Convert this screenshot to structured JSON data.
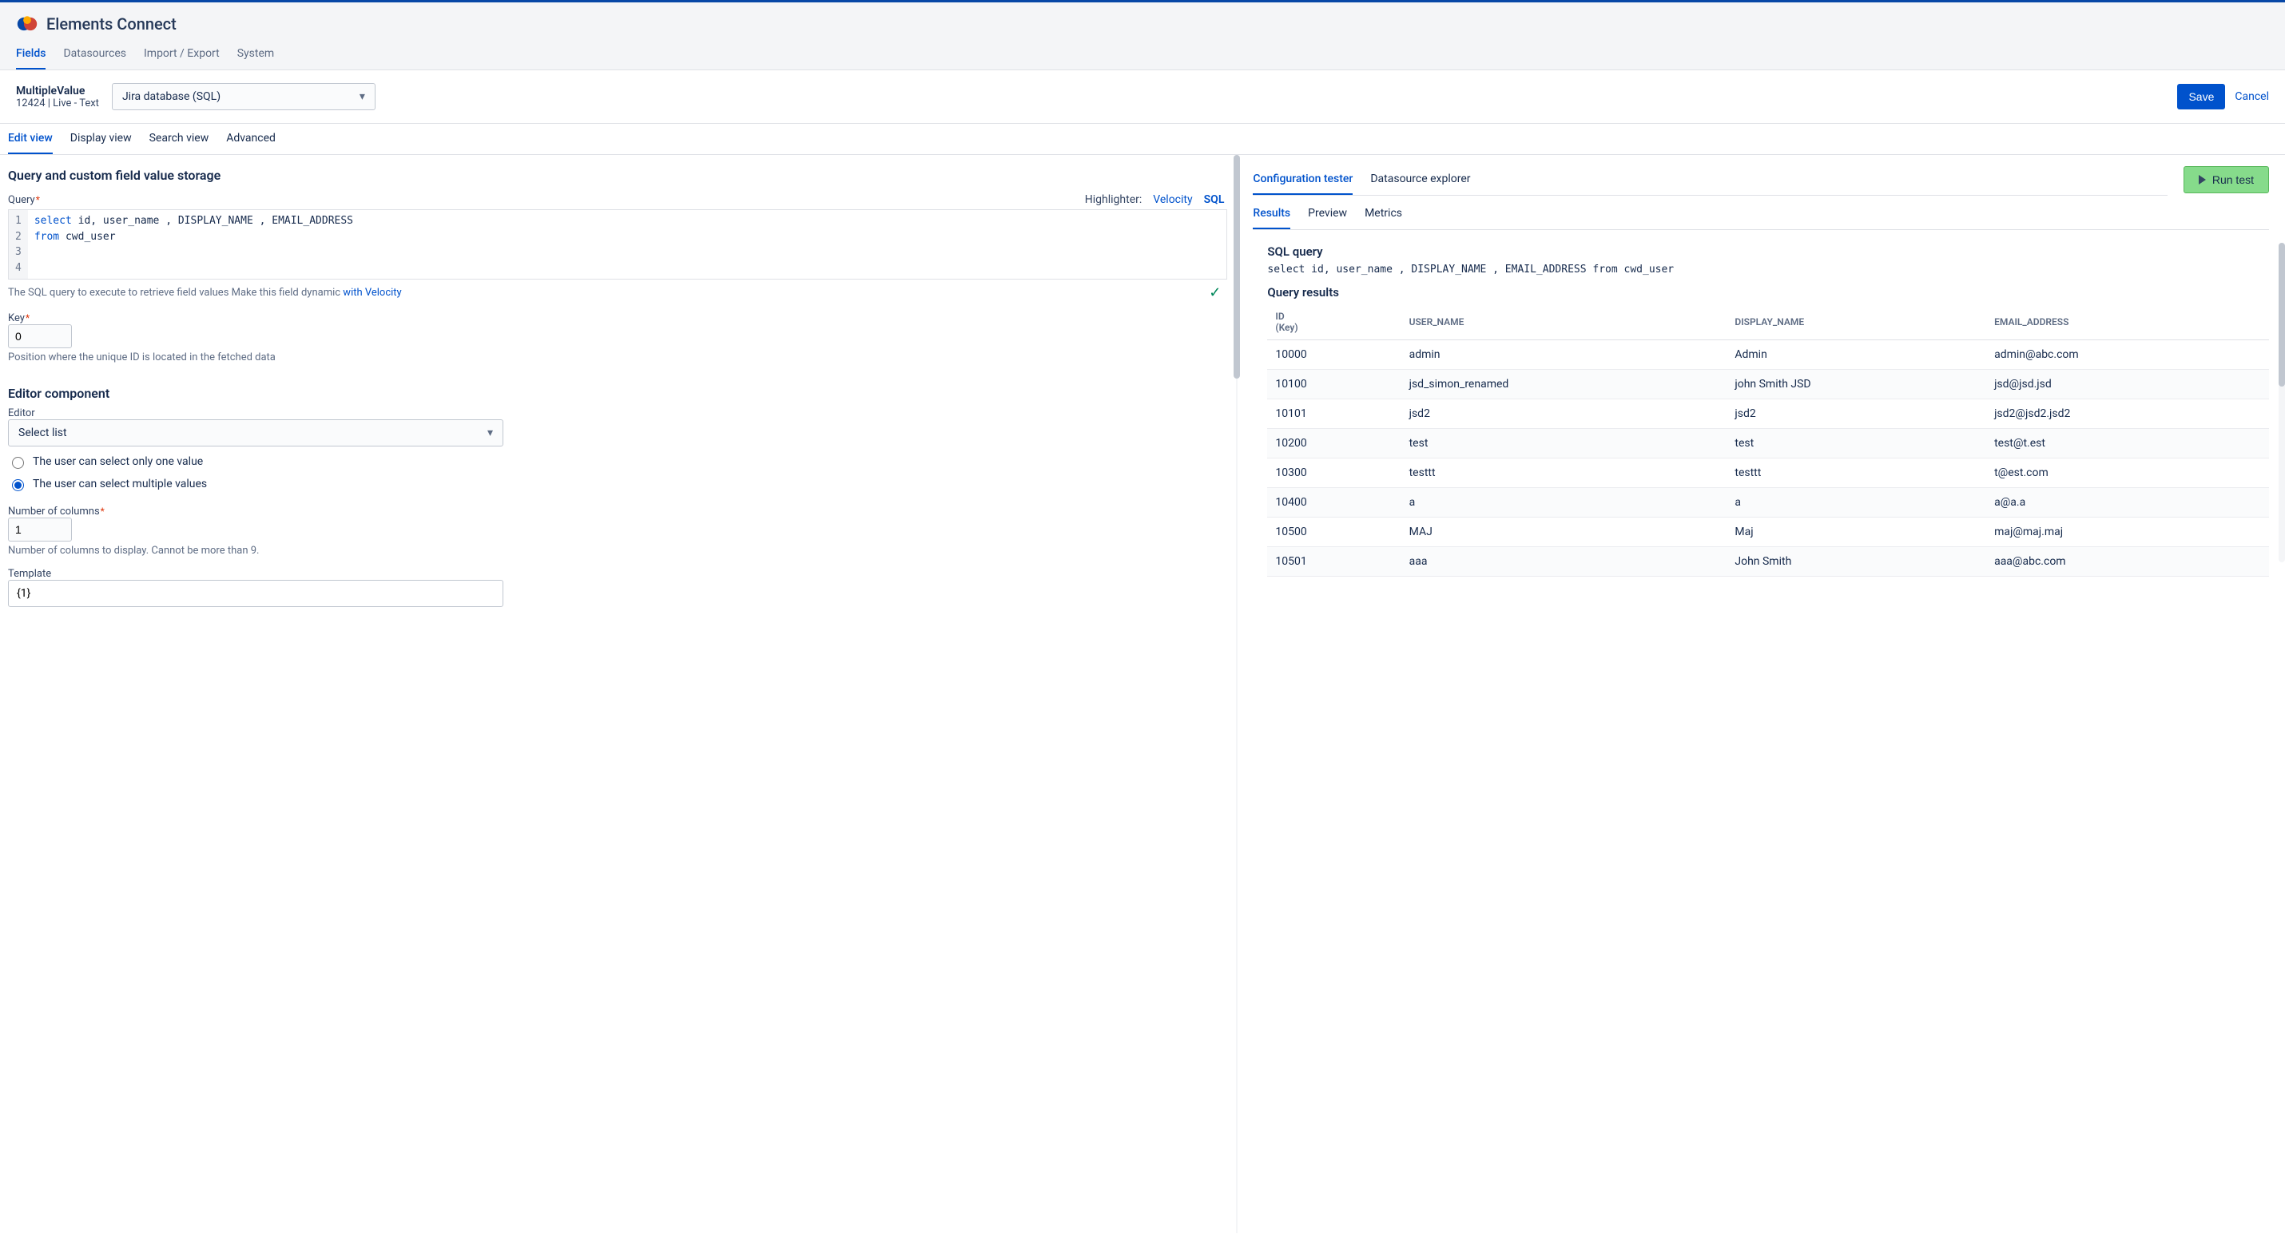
{
  "header": {
    "brand": "Elements Connect",
    "tabs": [
      "Fields",
      "Datasources",
      "Import / Export",
      "System"
    ],
    "activeTab": 0
  },
  "toolbar": {
    "fieldName": "MultipleValue",
    "fieldMeta": "12424 | Live - Text",
    "datasource": "Jira database (SQL)",
    "saveLabel": "Save",
    "cancelLabel": "Cancel"
  },
  "viewTabs": {
    "items": [
      "Edit view",
      "Display view",
      "Search view",
      "Advanced"
    ],
    "active": 0
  },
  "queryPanel": {
    "title": "Query and custom field value storage",
    "queryLabel": "Query",
    "highlighterLabel": "Highlighter:",
    "highlighterOptions": [
      "Velocity",
      "SQL"
    ],
    "code": {
      "line1_kw": "select",
      "line1_rest": " id, user_name , DISPLAY_NAME , EMAIL_ADDRESS",
      "line2_kw": "from",
      "line2_rest": " cwd_user"
    },
    "helpText": "The SQL query to execute to retrieve field values Make this field dynamic ",
    "helpLink": "with Velocity",
    "keyLabel": "Key",
    "keyValue": "0",
    "keyHint": "Position where the unique ID is located in the fetched data"
  },
  "editor": {
    "title": "Editor component",
    "editorLabel": "Editor",
    "editorType": "Select list",
    "radio": {
      "one": "The user can select only one value",
      "multiple": "The user can select multiple values"
    },
    "colsLabel": "Number of columns",
    "colsValue": "1",
    "colsHint": "Number of columns to display. Cannot be more than 9.",
    "templateLabel": "Template",
    "templateValue": "{1}"
  },
  "tester": {
    "tabs": [
      "Configuration tester",
      "Datasource explorer"
    ],
    "activeTab": 0,
    "runLabel": "Run test",
    "subTabs": [
      "Results",
      "Preview",
      "Metrics"
    ],
    "activeSubTab": 0,
    "sqlLabel": "SQL query",
    "sqlEcho": "select id, user_name , DISPLAY_NAME , EMAIL_ADDRESS from cwd_user",
    "resultsLabel": "Query results",
    "columns": [
      "ID (Key)",
      "USER_NAME",
      "DISPLAY_NAME",
      "EMAIL_ADDRESS"
    ],
    "rows": [
      {
        "id": "10000",
        "user": "admin",
        "display": "Admin",
        "email": "admin@abc.com"
      },
      {
        "id": "10100",
        "user": "jsd_simon_renamed",
        "display": "john Smith JSD",
        "email": "jsd@jsd.jsd"
      },
      {
        "id": "10101",
        "user": "jsd2",
        "display": "jsd2",
        "email": "jsd2@jsd2.jsd2"
      },
      {
        "id": "10200",
        "user": "test",
        "display": "test",
        "email": "test@t.est"
      },
      {
        "id": "10300",
        "user": "testtt",
        "display": "testtt",
        "email": "t@est.com"
      },
      {
        "id": "10400",
        "user": "a",
        "display": "a",
        "email": "a@a.a"
      },
      {
        "id": "10500",
        "user": "MAJ",
        "display": "Maj",
        "email": "maj@maj.maj"
      },
      {
        "id": "10501",
        "user": "aaa",
        "display": "John Smith",
        "email": "aaa@abc.com"
      }
    ]
  }
}
